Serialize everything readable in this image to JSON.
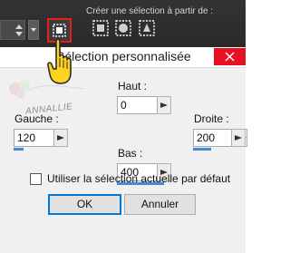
{
  "toolbar": {
    "create_selection_label": "Créer une sélection à partir de :",
    "icons": [
      "custom-selection-icon",
      "layer-opaque-icon",
      "mask-icon",
      "alpha-channel-icon"
    ]
  },
  "dialog": {
    "title": "Sélection personnalisée",
    "watermark": "ANNALLIE",
    "fields": {
      "haut": {
        "label": "Haut :",
        "value": "0"
      },
      "gauche": {
        "label": "Gauche :",
        "value": "120"
      },
      "droite": {
        "label": "Droite :",
        "value": "200"
      },
      "bas": {
        "label": "Bas :",
        "value": "400"
      }
    },
    "checkbox": {
      "label": "Utiliser la  sélection actuelle par défaut",
      "checked": false
    },
    "ok_label": "OK",
    "cancel_label": "Annuler"
  },
  "colors": {
    "accent": "#3c8bdc",
    "close": "#e81123",
    "highlight": "#e5201b",
    "toolbar_bg": "#2f2f2f"
  }
}
